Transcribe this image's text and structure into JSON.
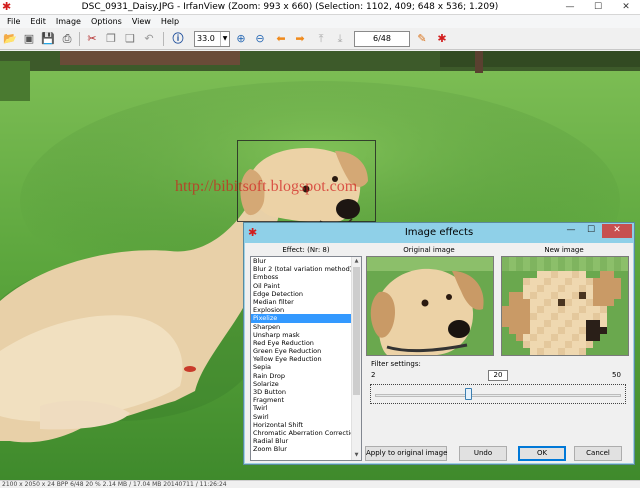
{
  "window": {
    "title": "DSC_0931_Daisy.JPG - IrfanView (Zoom: 993 x 660)  (Selection: 1102, 409; 648 x 536; 1.209)",
    "controls": {
      "minimize": "—",
      "maximize": "☐",
      "close": "✕"
    }
  },
  "menu": [
    "File",
    "Edit",
    "Image",
    "Options",
    "View",
    "Help"
  ],
  "toolbar": {
    "icons": [
      "open-folder-icon",
      "slideshow-icon",
      "save-icon",
      "print-icon",
      "cut-icon",
      "copy-icon",
      "paste-icon",
      "undo-icon",
      "info-icon",
      "zoom-in-icon",
      "zoom-out-icon",
      "previous-arrow-icon",
      "next-arrow-icon",
      "first-icon",
      "last-icon",
      "paint-icon",
      "irfanview-logo-icon"
    ],
    "zoom_value": "33.0",
    "page_indicator": "6/48"
  },
  "watermark": "http://bibitsoft.blogspot.com",
  "status": "2100 x 2050 x 24 BPP     6/48     20 %     2.14 MB / 17.04 MB     20140711 / 11:26:24",
  "dialog": {
    "title": "Image effects",
    "effect_header": "Effect:    (Nr: 8)",
    "effects": [
      "Blur",
      "Blur 2 (total variation method)",
      "Emboss",
      "Oil Paint",
      "Edge Detection",
      "Median filter",
      "Explosion",
      "Pixelize",
      "Sharpen",
      "Unsharp mask",
      "Red Eye Reduction",
      "Green Eye Reduction",
      "Yellow Eye Reduction",
      "Sepia",
      "Rain Drop",
      "Solarize",
      "3D Button",
      "Fragment",
      "Twirl",
      "Swirl",
      "Horizontal Shift",
      "Chromatic Aberration Correction",
      "Radial Blur",
      "Zoom Blur"
    ],
    "selected_index": 7,
    "original_label": "Original image",
    "new_label": "New image",
    "filter_label": "Filter settings:",
    "filter_min": "2",
    "filter_max": "50",
    "filter_value": "20",
    "slider_fraction": 0.375,
    "buttons": {
      "apply": "Apply to original image",
      "undo": "Undo",
      "ok": "OK",
      "cancel": "Cancel"
    }
  }
}
